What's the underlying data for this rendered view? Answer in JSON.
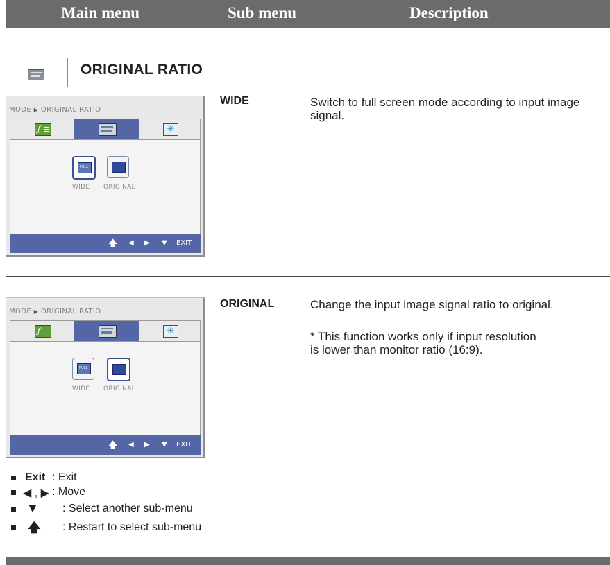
{
  "header": {
    "main_menu": "Main menu",
    "sub_menu": "Sub menu",
    "description": "Description"
  },
  "section": {
    "title": "ORIGINAL RATIO",
    "icon": "original-ratio-icon"
  },
  "osd": {
    "breadcrumb_mode": "MODE",
    "breadcrumb_page": "ORIGINAL RATIO",
    "tab_icons": [
      "f-engine-icon",
      "original-ratio-icon",
      "snowflake-icon"
    ],
    "tab2_text": "ORIGINAL\nRATIO",
    "options": [
      {
        "label": "WIDE",
        "icon": "full-screen-icon",
        "icon_text": "FULL"
      },
      {
        "label": "ORIGINAL",
        "icon": "original-screen-icon"
      }
    ],
    "footer": {
      "exit": "EXIT",
      "icons": [
        "restart-icon",
        "left-icon",
        "right-icon",
        "down-icon"
      ]
    }
  },
  "items": [
    {
      "name": "WIDE",
      "description": "Switch to full screen mode according to input image signal.",
      "selected_option": "WIDE"
    },
    {
      "name": "ORIGINAL",
      "description": "Change the input image signal ratio to original.",
      "note": "* This function works only if input resolution is lower than monitor ratio (16:9).",
      "selected_option": "ORIGINAL"
    }
  ],
  "legend": [
    {
      "key": "Exit",
      "text": ": Exit"
    },
    {
      "key": "◀ , ▶",
      "text": ": Move"
    },
    {
      "key": "▼",
      "text": ": Select another sub-menu"
    },
    {
      "key": "restart-icon",
      "text": ": Restart to select sub-menu"
    }
  ],
  "colors": {
    "header_bar": "#6b6b6b",
    "osd_accent": "#5466a6",
    "text": "#231f20"
  }
}
